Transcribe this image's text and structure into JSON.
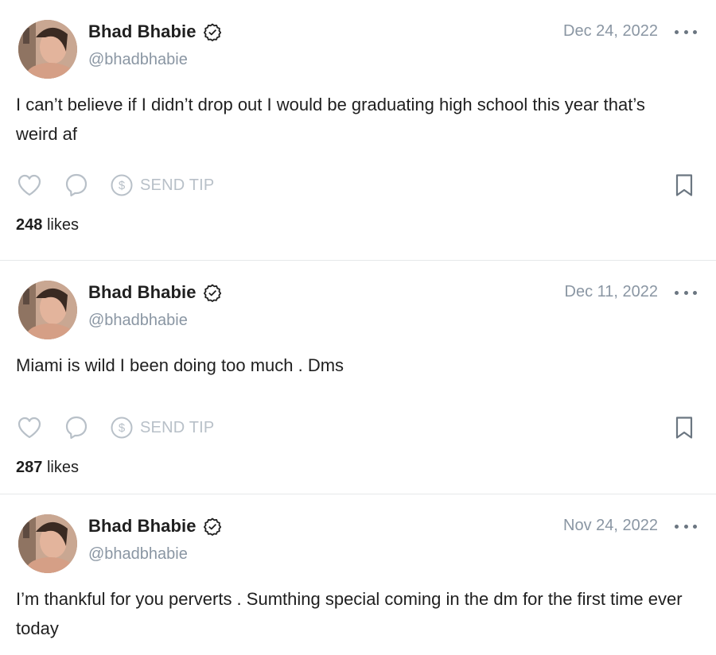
{
  "posts": [
    {
      "author": "Bhad Bhabie",
      "handle": "@bhadbhabie",
      "date": "Dec 24, 2022",
      "text": "I can’t believe if I didn’t drop out I would be graduating high school this year that’s weird af",
      "send_tip_label": "SEND TIP",
      "likes_count": "248",
      "likes_label": "likes"
    },
    {
      "author": "Bhad Bhabie",
      "handle": "@bhadbhabie",
      "date": "Dec 11, 2022",
      "text": "Miami is wild I been doing too much . Dms",
      "send_tip_label": "SEND TIP",
      "likes_count": "287",
      "likes_label": "likes"
    },
    {
      "author": "Bhad Bhabie",
      "handle": "@bhadbhabie",
      "date": "Nov 24, 2022",
      "text": "I’m thankful for you perverts . Sumthing special coming in the dm for the first time ever today"
    }
  ],
  "icons": {
    "like": "heart-icon",
    "comment": "comment-icon",
    "tip": "dollar-icon",
    "bookmark": "bookmark-icon",
    "more": "more-icon",
    "verified": "verified-icon"
  },
  "colors": {
    "text": "#1f1f1f",
    "muted": "#8a96a3",
    "icon": "#b8c0c8",
    "divider": "#e6e8ea"
  }
}
